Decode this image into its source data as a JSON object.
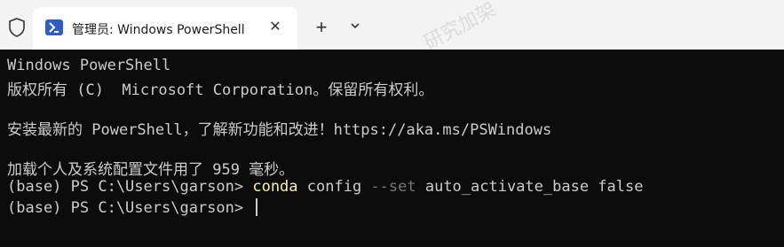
{
  "titlebar": {
    "tab_title": "管理员: Windows PowerShell",
    "tab_close_label": "✕",
    "new_tab_label": "+",
    "dropdown_label": "⌄",
    "watermark": "研究加架"
  },
  "terminal": {
    "line1": "Windows PowerShell",
    "line2": "版权所有 (C)  Microsoft Corporation。保留所有权利。",
    "line3": "安装最新的 PowerShell，了解新功能和改进！https://aka.ms/PSWindows",
    "line4": "加载个人及系统配置文件用了 959 毫秒。",
    "prompt": "(base) PS C:\\Users\\garson> ",
    "command": {
      "cmd": "conda",
      "sub": " config ",
      "param": "--set",
      "args": " auto_activate_base false"
    }
  },
  "colors": {
    "terminal_bg": "#0c0c0c",
    "terminal_text": "#cccccc",
    "command_yellow": "#f9f1a5",
    "parameter_gray": "#767676",
    "tab_icon_blue": "#2f5cc6"
  },
  "icons": {
    "shield": "shield-icon",
    "powershell": "powershell-icon",
    "close": "close-icon",
    "add": "plus-icon",
    "dropdown": "chevron-down-icon"
  }
}
